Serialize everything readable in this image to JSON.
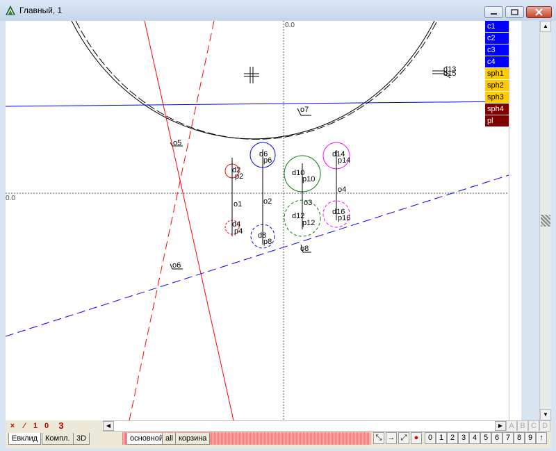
{
  "window": {
    "title": "Главный, 1"
  },
  "canvas": {
    "top_axis_label": "0.0",
    "left_axis_label": "0.0",
    "object_labels": [
      "d13",
      "d15",
      "o7",
      "o5",
      "d6",
      "p6",
      "d2",
      "p2",
      "d10",
      "p10",
      "d14",
      "p14",
      "o4",
      "o1",
      "o2",
      "o3",
      "d16",
      "p16",
      "d12",
      "p12",
      "d4",
      "p4",
      "d8",
      "p8",
      "o8",
      "o6"
    ]
  },
  "layers": [
    {
      "label": "c1",
      "bg": "#0000ff",
      "fg": "#ffffff"
    },
    {
      "label": "c2",
      "bg": "#0000ff",
      "fg": "#ffffff"
    },
    {
      "label": "c3",
      "bg": "#0000ff",
      "fg": "#ffffff"
    },
    {
      "label": "c4",
      "bg": "#0000ff",
      "fg": "#ffffff"
    },
    {
      "label": "sph1",
      "bg": "#ffcc00",
      "fg": "#000000"
    },
    {
      "label": "sph2",
      "bg": "#ffcc00",
      "fg": "#000000"
    },
    {
      "label": "sph3",
      "bg": "#ffcc00",
      "fg": "#000000"
    },
    {
      "label": "sph4",
      "bg": "#800000",
      "fg": "#ffffff"
    },
    {
      "label": "pl",
      "bg": "#800000",
      "fg": "#ffffff"
    }
  ],
  "tools": [
    "×",
    "⁄",
    "1",
    "0",
    "3"
  ],
  "left_tabs": [
    "Евклид",
    "Компл.",
    "3D"
  ],
  "layer_tabs": [
    "основной",
    "all",
    "корзина"
  ],
  "right_buttons": [
    "0",
    "1",
    "2",
    "3",
    "4",
    "5",
    "6",
    "7",
    "8",
    "9",
    "↑"
  ],
  "abcd": [
    "A",
    "B",
    "C",
    "D"
  ],
  "colors": {
    "blue": "#0000ff",
    "red": "#ff0000",
    "green": "#008000",
    "magenta": "#ff00ff",
    "darkred": "#c00000"
  }
}
